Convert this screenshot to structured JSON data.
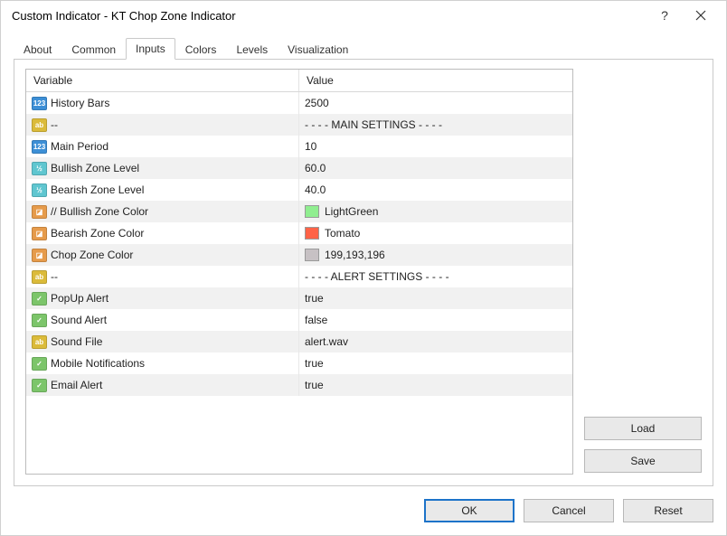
{
  "window": {
    "title": "Custom Indicator - KT Chop Zone Indicator"
  },
  "tabs": [
    {
      "label": "About"
    },
    {
      "label": "Common"
    },
    {
      "label": "Inputs",
      "active": true
    },
    {
      "label": "Colors"
    },
    {
      "label": "Levels"
    },
    {
      "label": "Visualization"
    }
  ],
  "grid": {
    "header_variable": "Variable",
    "header_value": "Value",
    "rows": [
      {
        "type": "int",
        "name": "History Bars",
        "value": "2500"
      },
      {
        "type": "str",
        "name": "--",
        "value": "- - - - MAIN SETTINGS - - - -"
      },
      {
        "type": "int",
        "name": "Main Period",
        "value": "10"
      },
      {
        "type": "dbl",
        "name": "Bullish Zone Level",
        "value": "60.0"
      },
      {
        "type": "dbl",
        "name": "Bearish Zone Level",
        "value": "40.0"
      },
      {
        "type": "color",
        "name": "// Bullish Zone Color",
        "value": "LightGreen",
        "swatch": "#90ee90"
      },
      {
        "type": "color",
        "name": "Bearish Zone Color",
        "value": "Tomato",
        "swatch": "#ff6347"
      },
      {
        "type": "color",
        "name": "Chop Zone Color",
        "value": "199,193,196",
        "swatch": "#c7c1c4"
      },
      {
        "type": "str",
        "name": "--",
        "value": "- - - - ALERT SETTINGS - - - -"
      },
      {
        "type": "bool",
        "name": "PopUp Alert",
        "value": "true"
      },
      {
        "type": "bool",
        "name": "Sound Alert",
        "value": "false"
      },
      {
        "type": "str",
        "name": "Sound File",
        "value": "alert.wav"
      },
      {
        "type": "bool",
        "name": "Mobile Notifications",
        "value": "true"
      },
      {
        "type": "bool",
        "name": "Email Alert",
        "value": "true"
      }
    ]
  },
  "icons": {
    "int": "123",
    "str": "ab",
    "dbl": "½",
    "color": "◪",
    "bool": "✓"
  },
  "buttons": {
    "load": "Load",
    "save": "Save",
    "ok": "OK",
    "cancel": "Cancel",
    "reset": "Reset"
  }
}
